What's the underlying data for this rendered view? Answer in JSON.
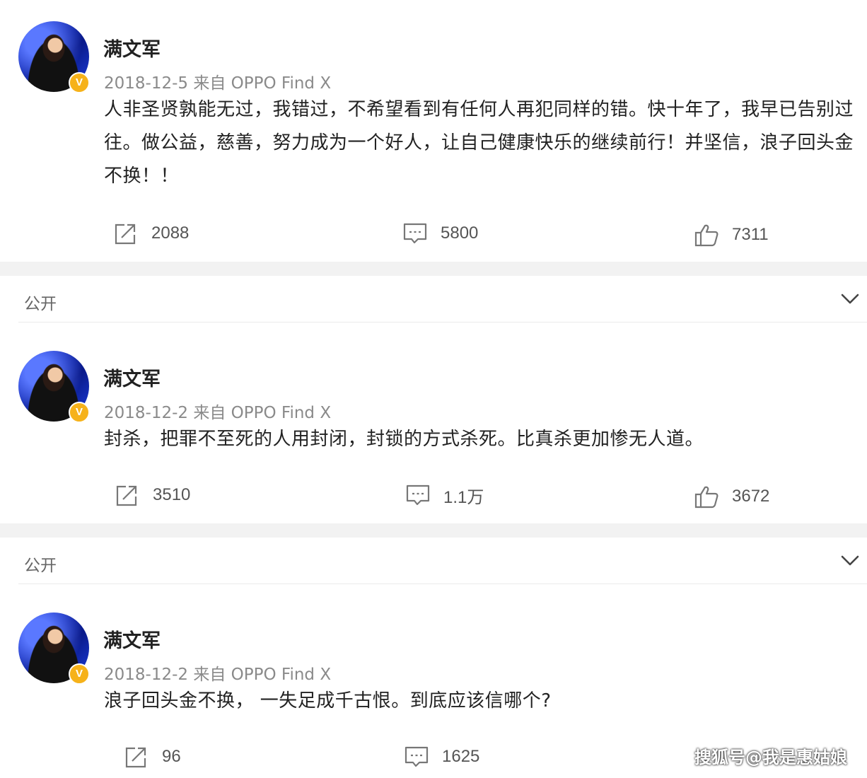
{
  "posts": [
    {
      "author": "满文军",
      "meta": "2018-12-5 来自 OPPO Find X",
      "verified_badge": "V",
      "text": "人非圣贤孰能无过，我错过，不希望看到有任何人再犯同样的错。快十年了，我早已告别过往。做公益，慈善，努力成为一个好人，让自己健康快乐的继续前行！并坚信，浪子回头金不换！！",
      "reposts": "2088",
      "comments": "5800",
      "likes": "7311"
    },
    {
      "author": "满文军",
      "meta": "2018-12-2 来自 OPPO Find X",
      "verified_badge": "V",
      "text": "封杀，把罪不至死的人用封闭，封锁的方式杀死。比真杀更加惨无人道。",
      "reposts": "3510",
      "comments": "1.1万",
      "likes": "3672"
    },
    {
      "author": "满文军",
      "meta": "2018-12-2 来自 OPPO Find X",
      "verified_badge": "V",
      "text": "浪子回头金不换， 一失足成千古恨。到底应该信哪个?",
      "reposts": "96",
      "comments": "1625",
      "likes": ""
    }
  ],
  "groups": [
    {
      "label": "公开"
    },
    {
      "label": "公开"
    }
  ],
  "watermark": "搜狐号@我是惠姑娘",
  "icons": {
    "repost": "repost-icon",
    "comment": "comment-icon",
    "like": "thumbs-up-icon",
    "expand": "chevron-down-icon"
  }
}
